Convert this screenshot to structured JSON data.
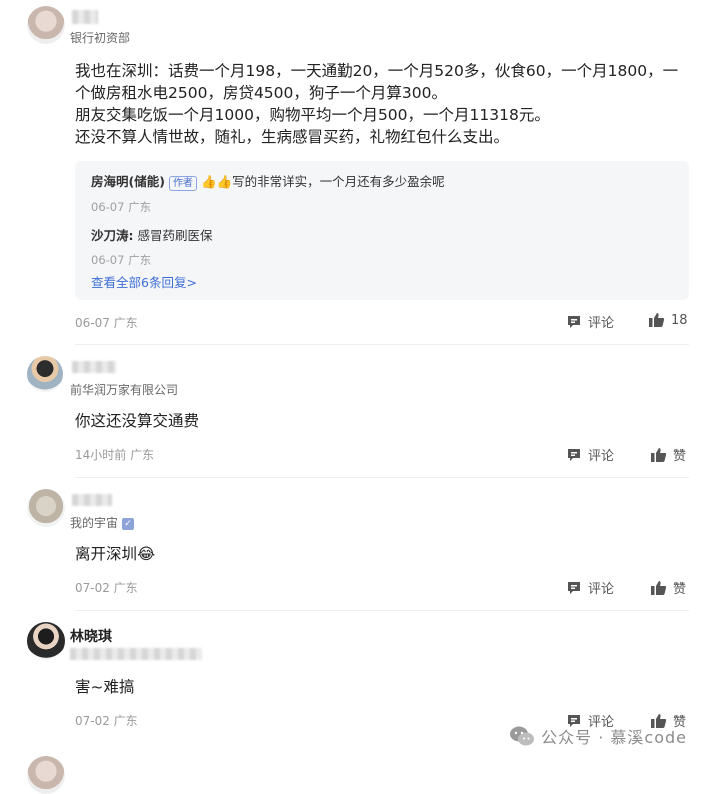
{
  "comments": [
    {
      "org": "银行初资部",
      "content": [
        "我也在深圳：话费一个月198，一天通勤20，一个月520多，伙食60，一个月1800，一个做房租水电2500，房贷4500，狗子一个月算300。",
        "朋友交集吃饭一个月1000，购物平均一个月500，一个月11318元。",
        "还没不算人情世故，随礼，生病感冒买药，礼物红包什么支出。"
      ],
      "replies": [
        {
          "name": "房海明(储能)",
          "tag": "作者",
          "text": "👍👍写的非常详实，一个月还有多少盈余呢",
          "meta": "06-07 广东"
        },
        {
          "name": "沙刀涛:",
          "text": "感冒药刷医保",
          "meta": "06-07 广东"
        }
      ],
      "more_replies": "查看全部6条回复>",
      "meta": "06-07 广东",
      "comment_label": "评论",
      "like_label": "18"
    },
    {
      "org": "前华润万家有限公司",
      "content": "你这还没算交通费",
      "meta": "14小时前 广东",
      "comment_label": "评论",
      "like_label": "赞"
    },
    {
      "org": "我的宇宙",
      "content": "离开深圳😂",
      "meta": "07-02 广东",
      "comment_label": "评论",
      "like_label": "赞"
    },
    {
      "name": "林晓琪",
      "content": "害~难搞",
      "meta": "07-02 广东",
      "comment_label": "评论",
      "like_label": "赞"
    }
  ],
  "watermark": "公众号 · 慕溪code"
}
